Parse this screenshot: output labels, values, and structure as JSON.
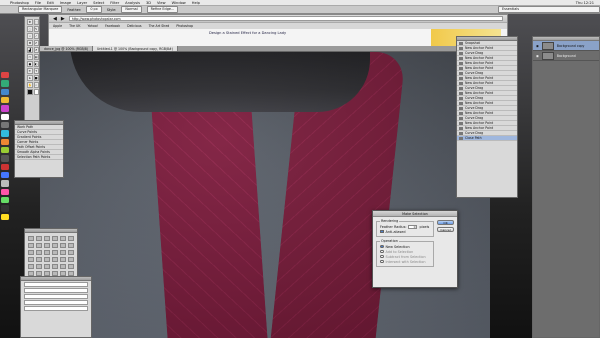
{
  "menubar": {
    "apple": "",
    "items": [
      "Photoshop",
      "File",
      "Edit",
      "Image",
      "Layer",
      "Select",
      "Filter",
      "Analysis",
      "3D",
      "View",
      "Window",
      "Help"
    ],
    "clock": "Thu 12:21"
  },
  "options": {
    "tool": "Rectangular Marquee",
    "feather_label": "Feather:",
    "feather_value": "0 px",
    "style_label": "Style:",
    "style_value": "Normal",
    "refine_label": "Refine Edge...",
    "workspace": "Essentials"
  },
  "browser": {
    "url": "http://www.photoshopstar.com",
    "bookmarks": [
      "Apple",
      "The UK",
      "Yahoo!",
      "Facebook",
      "Delicious",
      "The Art Shed",
      "Photoshop"
    ],
    "page_heading": "Design a Stained Effect for a Dancing Lady"
  },
  "document": {
    "tabs": [
      {
        "label": "dance_jpg @ 100% (RGB/8)",
        "active": false
      },
      {
        "label": "Untitled-1 @ 100% (Background copy, RGB/8#)",
        "active": true
      }
    ]
  },
  "history": {
    "items": [
      "Snapshot",
      "New Anchor Point",
      "Curve Drag",
      "New Anchor Point",
      "New Anchor Point",
      "New Anchor Point",
      "Curve Drag",
      "New Anchor Point",
      "New Anchor Point",
      "Curve Drag",
      "New Anchor Point",
      "Curve Drag",
      "New Anchor Point",
      "Curve Drag",
      "New Anchor Point",
      "Curve Drag",
      "New Anchor Point",
      "New Anchor Point",
      "Curve Drag",
      "Close Path"
    ],
    "selected_index": 19
  },
  "layers": {
    "items": [
      {
        "name": "Background copy",
        "selected": true
      },
      {
        "name": "Background",
        "selected": false
      }
    ]
  },
  "paths_panel": {
    "items": [
      "Work Path",
      "Curve Points",
      "Gradient Points",
      "Corner Points",
      "Path Offset Points",
      "Smooth Alpha Points",
      "Selection Path Points"
    ]
  },
  "dialog": {
    "title": "Make Selection",
    "rendering_legend": "Rendering",
    "feather_label": "Feather Radius:",
    "feather_value": "0",
    "feather_unit": "pixels",
    "antialias_label": "Anti-aliased",
    "operation_legend": "Operation",
    "ops": [
      "New Selection",
      "Add to Selection",
      "Subtract from Selection",
      "Intersect with Selection"
    ],
    "ok": "OK",
    "cancel": "Cancel"
  },
  "dock_colors": [
    "#d44",
    "#3a7",
    "#48c",
    "#eb3",
    "#c4c",
    "#fff",
    "#777",
    "#3bd",
    "#e83",
    "#9c3",
    "#555",
    "#c33",
    "#47f",
    "#bbb",
    "#f5a",
    "#6d6",
    "#333",
    "#fd2"
  ]
}
